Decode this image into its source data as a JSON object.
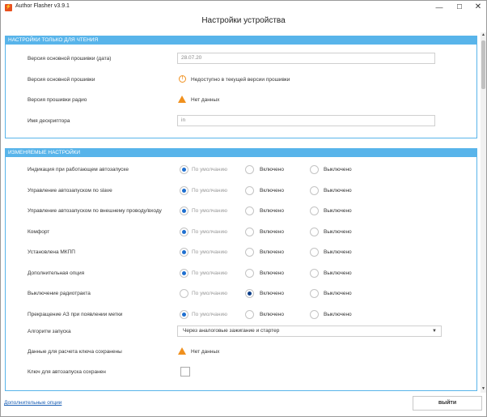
{
  "window": {
    "app_title": "Author Flasher v3.9.1",
    "minimize": "—",
    "maximize": "☐",
    "close": "✕"
  },
  "page": {
    "title": "Настройки устройства"
  },
  "readonly_section": {
    "header": "НАСТРОЙКИ ТОЛЬКО ДЛЯ ЧТЕНИЯ",
    "firmware_date": {
      "label": "Версия основной прошивки (дата)",
      "value": "28.07.20"
    },
    "firmware_version": {
      "label": "Версия основной прошивки",
      "value": "Недоступно в текущей версии прошивки",
      "icon": "info-icon"
    },
    "radio_firmware": {
      "label": "Версия прошивки радио",
      "value": "Нет данных",
      "icon": "warning-icon"
    },
    "descriptor_name": {
      "label": "Имя дескриптора",
      "value": "in"
    }
  },
  "editable_section": {
    "header": "ИЗМЕНЯЕМЫЕ НАСТРОЙКИ",
    "options": {
      "default": "По умолчанию",
      "on": "Включено",
      "off": "Выключено"
    },
    "rows": [
      {
        "label": "Индикация при работающем автозапуске",
        "selected": "default"
      },
      {
        "label": "Управление автозапуском по slave",
        "selected": "default"
      },
      {
        "label": "Управление автозапуском по внешнему проводу/входу",
        "selected": "default"
      },
      {
        "label": "Комфорт",
        "selected": "default"
      },
      {
        "label": "Установлена МКПП",
        "selected": "default"
      },
      {
        "label": "Дополнительная опция",
        "selected": "default"
      },
      {
        "label": "Выключение радиотракта",
        "selected": "on"
      },
      {
        "label": "Прекращение АЗ при появлении метки",
        "selected": "default"
      }
    ],
    "start_algorithm": {
      "label": "Алгоритм запуска",
      "value": "Через аналоговые зажигание и стартер"
    },
    "key_data": {
      "label": "Данные для расчета ключа сохранены",
      "value": "Нет данных",
      "icon": "warning-icon"
    },
    "key_saved": {
      "label": "Ключ для автозапуска сохранен",
      "checked": false
    }
  },
  "footer": {
    "link": "Дополнительные опции",
    "exit_button": "выйти"
  },
  "colors": {
    "accent": "#58b4ea",
    "radio_checked": "#1e6fd0",
    "warning": "#f0901e",
    "brand": "#e8501e"
  }
}
